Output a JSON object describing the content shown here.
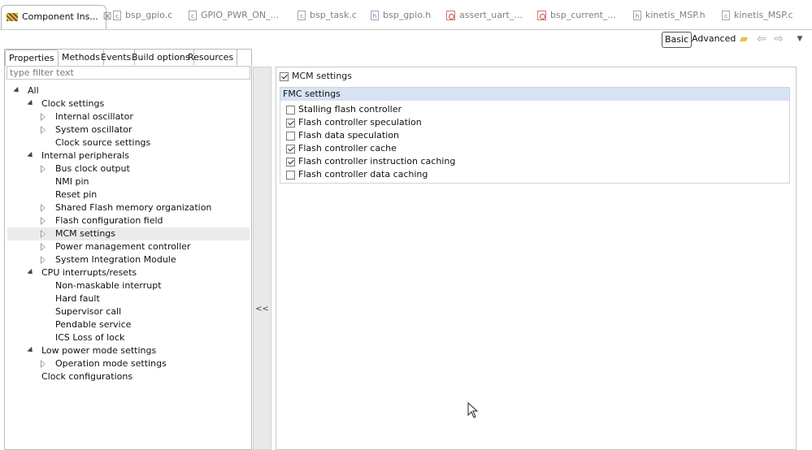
{
  "editor_tabs": [
    {
      "label": "Component Ins...",
      "icon": "component-grid-icon",
      "active": true
    },
    {
      "label": "bsp_gpio.c",
      "icon": "c-file-icon"
    },
    {
      "label": "GPIO_PWR_ON_...",
      "icon": "c-file-icon"
    },
    {
      "label": "bsp_task.c",
      "icon": "c-file-icon"
    },
    {
      "label": "bsp_gpio.h",
      "icon": "h-file-icon"
    },
    {
      "label": "assert_uart_...",
      "icon": "reference-file-icon"
    },
    {
      "label": "bsp_current_...",
      "icon": "reference-file-icon"
    },
    {
      "label": "kinetis_MSP.h",
      "icon": "h-file-icon"
    },
    {
      "label": "kinetis_MSP.c",
      "icon": "c-file-icon"
    }
  ],
  "toolbar": {
    "basic_label": "Basic",
    "advanced_label": "Advanced"
  },
  "panel_tabs": [
    "Properties",
    "Methods",
    "Events",
    "Build options",
    "Resources"
  ],
  "filter": {
    "placeholder": "type filter text"
  },
  "tree": [
    {
      "label": "All",
      "level": 0,
      "state": "open"
    },
    {
      "label": "Clock settings",
      "level": 1,
      "state": "open"
    },
    {
      "label": "Internal oscillator",
      "level": 2,
      "state": "closed"
    },
    {
      "label": "System oscillator",
      "level": 2,
      "state": "closed"
    },
    {
      "label": "Clock source settings",
      "level": 2,
      "state": "leaf"
    },
    {
      "label": "Internal peripherals",
      "level": 1,
      "state": "open"
    },
    {
      "label": "Bus clock output",
      "level": 2,
      "state": "closed"
    },
    {
      "label": "NMI pin",
      "level": 2,
      "state": "leaf"
    },
    {
      "label": "Reset pin",
      "level": 2,
      "state": "leaf"
    },
    {
      "label": "Shared Flash memory organization",
      "level": 2,
      "state": "closed"
    },
    {
      "label": "Flash configuration field",
      "level": 2,
      "state": "closed"
    },
    {
      "label": "MCM settings",
      "level": 2,
      "state": "closed",
      "selected": true
    },
    {
      "label": "Power management controller",
      "level": 2,
      "state": "closed"
    },
    {
      "label": "System Integration Module",
      "level": 2,
      "state": "closed"
    },
    {
      "label": "CPU interrupts/resets",
      "level": 1,
      "state": "open"
    },
    {
      "label": "Non-maskable interrupt",
      "level": 2,
      "state": "leaf"
    },
    {
      "label": "Hard fault",
      "level": 2,
      "state": "leaf"
    },
    {
      "label": "Supervisor call",
      "level": 2,
      "state": "leaf"
    },
    {
      "label": "Pendable service",
      "level": 2,
      "state": "leaf"
    },
    {
      "label": "ICS Loss of lock",
      "level": 2,
      "state": "leaf"
    },
    {
      "label": "Low power mode settings",
      "level": 1,
      "state": "open"
    },
    {
      "label": "Operation mode settings",
      "level": 2,
      "state": "closed"
    },
    {
      "label": "Clock configurations",
      "level": 1,
      "state": "leaf"
    }
  ],
  "splitter": {
    "collapse_label": "<<"
  },
  "mcm": {
    "label": "MCM settings",
    "checked": true
  },
  "fmc": {
    "header": "FMC settings",
    "options": [
      {
        "label": "Stalling flash controller",
        "checked": false
      },
      {
        "label": "Flash controller speculation",
        "checked": true
      },
      {
        "label": "Flash data speculation",
        "checked": false
      },
      {
        "label": "Flash controller cache",
        "checked": true
      },
      {
        "label": "Flash controller instruction caching",
        "checked": true
      },
      {
        "label": "Flash controller data caching",
        "checked": false
      }
    ]
  },
  "colors": {
    "section_header_bg": "#d7e3f2",
    "selected_row_bg": "#ebebeb"
  }
}
